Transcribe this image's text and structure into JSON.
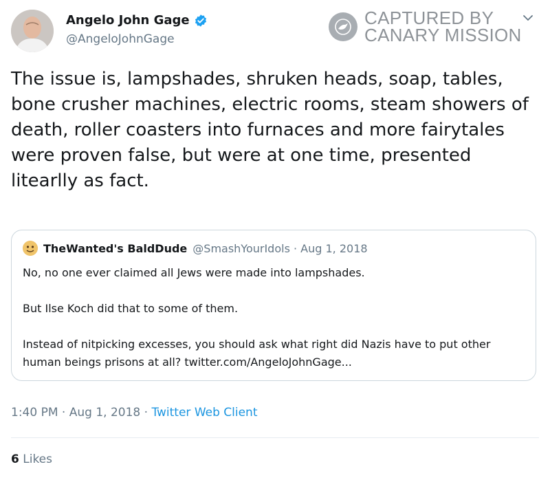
{
  "author": {
    "name": "Angelo John Gage",
    "handle": "@AngeloJohnGage",
    "verified_icon": "verified-badge-icon"
  },
  "watermark": {
    "line1": "CAPTURED BY",
    "line2": "CANARY MISSION"
  },
  "tweet": {
    "text": "The issue is, lampshades, shruken heads, soap, tables, bone crusher machines, electric rooms, steam showers of death, roller coasters into furnaces and more fairytales were proven false, but were at one time, presented litearlly as fact."
  },
  "quote": {
    "name": "TheWanted's BaldDude",
    "handle": "@SmashYourIdols",
    "separator": " · ",
    "date": "Aug 1, 2018",
    "paragraphs": [
      "No, no one ever claimed all Jews were made into lampshades.",
      "But Ilse Koch did that to some of them.",
      "Instead of nitpicking excesses, you should ask what right did Nazis have to put other human beings prisons at all? twitter.com/AngeloJohnGage..."
    ]
  },
  "meta": {
    "time": "1:40 PM",
    "sep1": " · ",
    "date": "Aug 1, 2018",
    "sep2": " · ",
    "client": "Twitter Web Client"
  },
  "stats": {
    "likes_count": "6",
    "likes_label": "Likes"
  },
  "colors": {
    "link": "#1b95e0",
    "secondary_text": "#657786",
    "verified": "#1da1f2"
  }
}
